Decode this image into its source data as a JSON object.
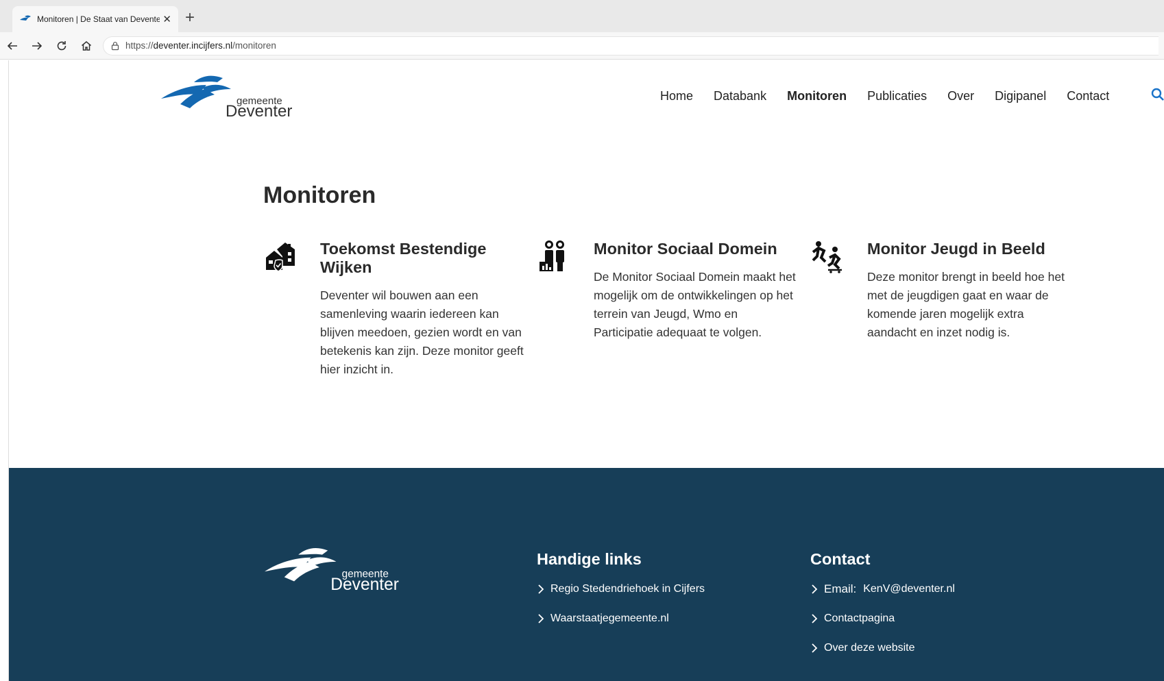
{
  "browser": {
    "tab_title": "Monitoren | De Staat van Deventer",
    "tab_close": "✕",
    "new_tab": "+",
    "url_scheme": "https://",
    "url_host": "deventer.incijfers.nl",
    "url_path": "/monitoren"
  },
  "header": {
    "logo_small": "gemeente",
    "logo_big": "Deventer",
    "nav": [
      "Home",
      "Databank",
      "Monitoren",
      "Publicaties",
      "Over",
      "Digipanel",
      "Contact"
    ],
    "active_nav": "Monitoren"
  },
  "main": {
    "title": "Monitoren",
    "cards": [
      {
        "title": "Toekomst Bestendige Wijken",
        "text": "Deventer wil bouwen aan een samenleving waarin iedereen kan blijven meedoen, gezien wordt en van betekenis kan zijn. Deze monitor geeft hier inzicht in.",
        "icon": "houses-shield-icon"
      },
      {
        "title": "Monitor Sociaal Domein",
        "text": "De Monitor Sociaal Domein maakt het mogelijk om de ontwikkelingen op het terrein van Jeugd, Wmo en Participatie adequaat te volgen.",
        "icon": "people-chart-icon"
      },
      {
        "title": "Monitor Jeugd in Beeld",
        "text": "Deze monitor brengt in beeld hoe het met de jeugdigen gaat en waar de komende jaren mogelijk extra aandacht en inzet nodig is.",
        "icon": "youth-skating-icon"
      }
    ]
  },
  "footer": {
    "logo_small": "gemeente",
    "logo_big": "Deventer",
    "links_title": "Handige links",
    "links": [
      "Regio Stedendriehoek in Cijfers",
      "Waarstaatjegemeente.nl"
    ],
    "contact_title": "Contact",
    "email_label": "Email:",
    "email": "KenV@deventer.nl",
    "contact_links": [
      "Contactpagina",
      "Over deze website"
    ]
  },
  "colors": {
    "brand_blue": "#1468b1",
    "footer_bg": "#173e58",
    "search_blue": "#1a73c9"
  }
}
